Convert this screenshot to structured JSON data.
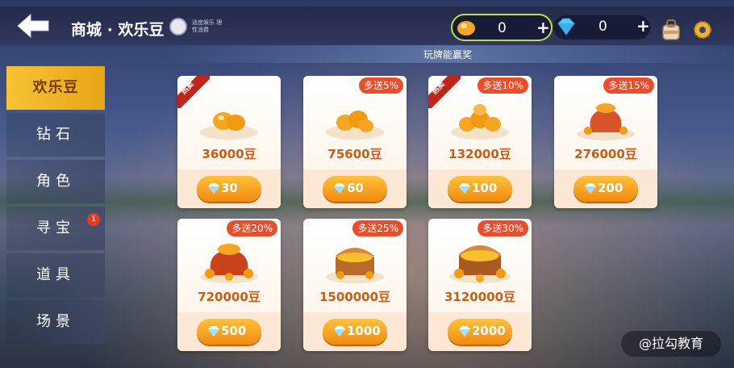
{
  "header": {
    "title": "商城 · 欢乐豆",
    "health_note": "适度娱乐 理性消费",
    "beans": "0",
    "beans_plus": "+",
    "diamonds": "0",
    "diamonds_plus": "+"
  },
  "banner": "玩牌能赢奖",
  "sidebar": {
    "items": [
      {
        "label": "欢乐豆"
      },
      {
        "label": "钻石"
      },
      {
        "label": "角色"
      },
      {
        "label": "寻宝",
        "badge": "1"
      },
      {
        "label": "道具"
      },
      {
        "label": "场景"
      }
    ]
  },
  "hot_label": "热卖",
  "cards": [
    {
      "amount": "36000豆",
      "price": "30",
      "hot": true,
      "bonus": ""
    },
    {
      "amount": "75600豆",
      "price": "60",
      "hot": false,
      "bonus": "多送5%"
    },
    {
      "amount": "132000豆",
      "price": "100",
      "hot": true,
      "bonus": "多送10%"
    },
    {
      "amount": "276000豆",
      "price": "200",
      "hot": false,
      "bonus": "多送15%"
    },
    {
      "amount": "720000豆",
      "price": "500",
      "hot": false,
      "bonus": "多送20%"
    },
    {
      "amount": "1500000豆",
      "price": "1000",
      "hot": false,
      "bonus": "多送25%"
    },
    {
      "amount": "3120000豆",
      "price": "2000",
      "hot": false,
      "bonus": "多送30%"
    }
  ],
  "watermark": "@拉勾教育",
  "colors": {
    "accent": "#f7c335",
    "price_button": "#f08a10",
    "bonus_tag": "#e94e2c",
    "bean_border": "#b9e04a"
  }
}
